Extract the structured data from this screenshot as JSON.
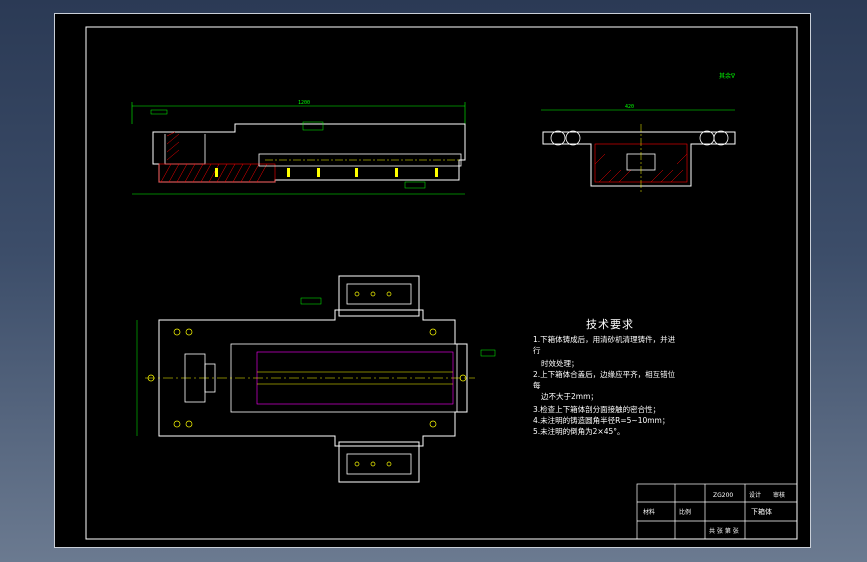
{
  "drawing": {
    "colors": {
      "background": "#000000",
      "outline": "#ffffff",
      "dimension": "#00ff00",
      "hatch": "#ff0000",
      "centerline": "#ffff00",
      "hidden": "#ff00ff",
      "holes": "#ffff00"
    },
    "top_view_dimension": "1200",
    "side_view_dimension": "420",
    "roughness_mark": "其余∇",
    "technical_requirements": {
      "title": "技术要求",
      "items": [
        "1.下箱体铸成后，用清砂机清理铸件，并进",
        "行",
        "时效处理；",
        "2.上下箱体合盖后，边缘应平齐，相互错位",
        "每",
        "边不大于2mm；",
        "3.检查上下箱体剖分面接触的密合性；",
        "4.未注明的铸造圆角半径R=5~10mm；",
        "5.未注明的倒角为2×45°。"
      ]
    },
    "title_block": {
      "part_name": "下箱体",
      "drawing_no": "ZG200",
      "scale_label": "比例",
      "material_label": "材料",
      "sheet": "共 张 第 张",
      "designer_label": "设计",
      "checker_label": "审核"
    }
  }
}
